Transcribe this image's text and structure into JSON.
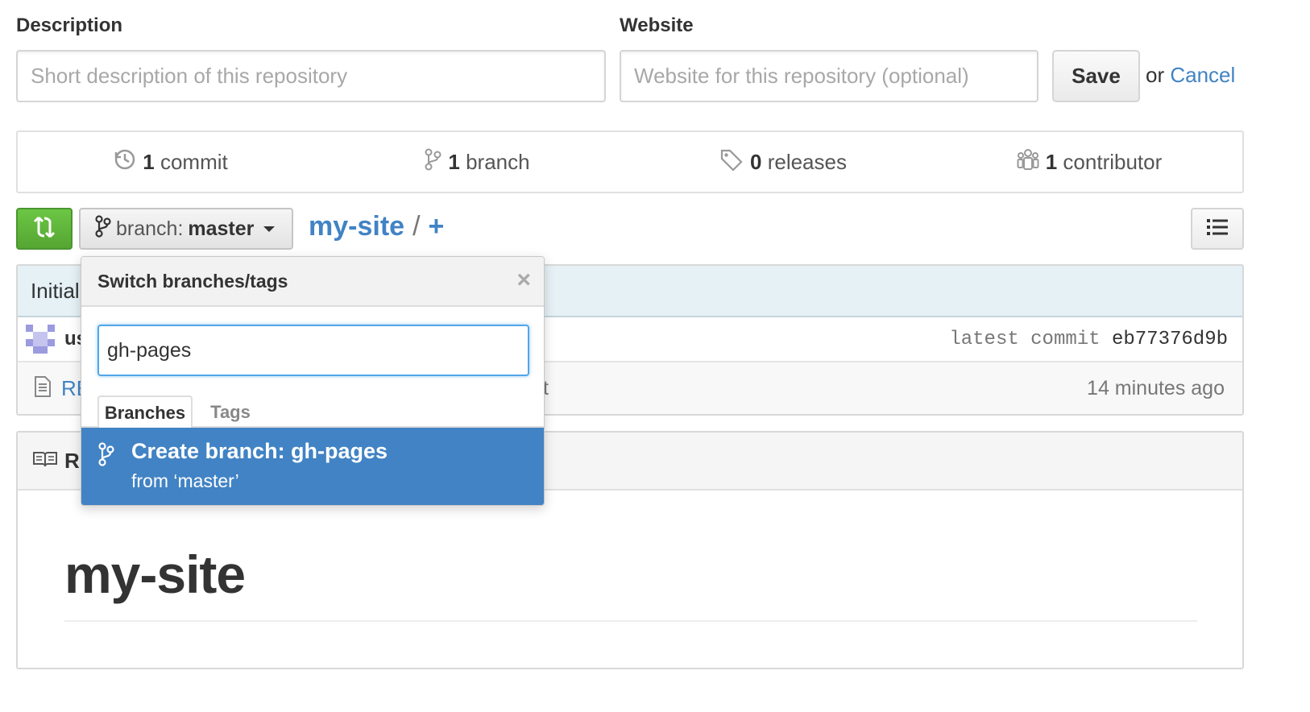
{
  "repo_meta": {
    "description_label": "Description",
    "description_placeholder": "Short description of this repository",
    "website_label": "Website",
    "website_placeholder": "Website for this repository (optional)",
    "save_label": "Save",
    "or_text": "or",
    "cancel_label": "Cancel"
  },
  "summary": {
    "commits": {
      "count": "1",
      "label": "commit"
    },
    "branches": {
      "count": "1",
      "label": "branch"
    },
    "releases": {
      "count": "0",
      "label": "releases"
    },
    "contributors": {
      "count": "1",
      "label": "contributor"
    }
  },
  "file_nav": {
    "branch_prefix": "branch:",
    "branch_name": "master",
    "repo_name": "my-site",
    "separator": "/",
    "add_label": "+"
  },
  "commit": {
    "message_partial": "Initial",
    "author_partial": "us",
    "sha_label": "latest commit",
    "sha": "eb77376d9b"
  },
  "files": [
    {
      "name_partial": "RE",
      "message_partial": "t",
      "age": "14 minutes ago"
    }
  ],
  "readme": {
    "header_partial": "R",
    "title": "my-site"
  },
  "branch_dropdown": {
    "title": "Switch branches/tags",
    "close_glyph": "×",
    "filter_value": "gh-pages",
    "tabs": [
      "Branches",
      "Tags"
    ],
    "active_tab": "Branches",
    "create_title": "Create branch: gh-pages",
    "create_from": "from ‘master’"
  },
  "colors": {
    "link": "#4183c4",
    "compare_green": "#55a532",
    "selected_item_bg": "#4183c4",
    "commit_bar_bg": "#e6f1f6"
  }
}
